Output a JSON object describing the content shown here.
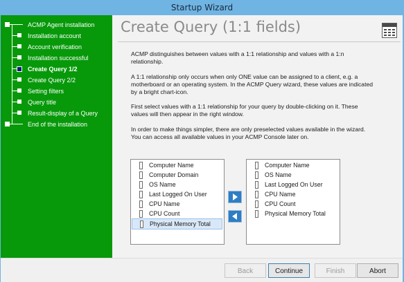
{
  "window": {
    "title": "Startup Wizard"
  },
  "sidebar": {
    "steps": [
      {
        "label": "ACMP Agent installation"
      },
      {
        "label": "Installation account"
      },
      {
        "label": "Account verification"
      },
      {
        "label": "Installation successful"
      },
      {
        "label": "Create Query 1/2"
      },
      {
        "label": "Create Query 2/2"
      },
      {
        "label": "Setting filters"
      },
      {
        "label": "Query title"
      },
      {
        "label": "Result-display of a Query"
      },
      {
        "label": "End of the installation"
      }
    ],
    "current_step": "Create Query 1/2"
  },
  "main": {
    "title": "Create Query (1:1 fields)",
    "header_icon": "table-icon",
    "paragraphs": [
      "ACMP distinguishes between values with a 1:1 relationship and values with a 1:n relationship.",
      "A 1:1 relationship only occurs when only ONE value can be assigned to a client, e.g. a motherboard or an operating system. In the ACMP Query wizard, these values are indicated by a bright chart-icon.",
      "First select values with a 1:1 relationship for your query by double-clicking on it. These values will then appear in the right window.",
      "In order to make things simpler, there are only preselected values available in the wizard. You can access all available values in your ACMP Console later on."
    ],
    "available_fields": [
      "Computer Name",
      "Computer Domain",
      "OS Name",
      "Last Logged On User",
      "CPU Name",
      "CPU Count",
      "Physical Memory Total"
    ],
    "selected_available_field": "Physical Memory Total",
    "chosen_fields": [
      "Computer Name",
      "OS Name",
      "Last Logged On User",
      "CPU Name",
      "CPU Count",
      "Physical Memory Total"
    ],
    "add_button_icon": "arrow-right-icon",
    "remove_button_icon": "arrow-left-icon"
  },
  "footer": {
    "back_label": "Back",
    "continue_label": "Continue",
    "finish_label": "Finish",
    "abort_label": "Abort"
  },
  "colors": {
    "sidebar": "#07990a",
    "titlebar": "#6fb4e3",
    "arrow_button": "#2d7ec4",
    "current_step_box": "#0b1d6e"
  }
}
